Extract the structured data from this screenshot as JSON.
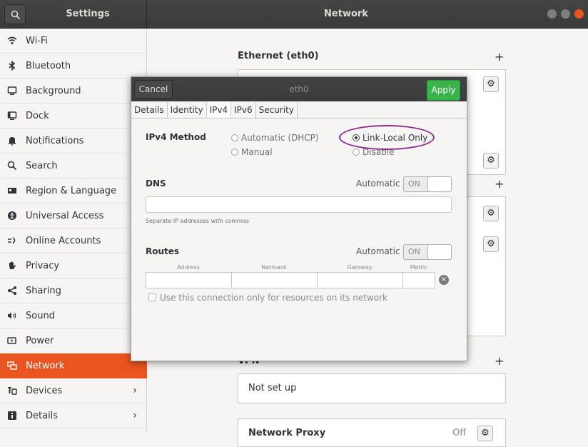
{
  "header": {
    "left_title": "Settings",
    "title": "Network"
  },
  "sidebar": {
    "items": [
      {
        "label": "Wi-Fi",
        "icon": "wifi-icon",
        "glyph": "•"
      },
      {
        "label": "Bluetooth",
        "icon": "bluetooth-icon",
        "glyph": "✲"
      },
      {
        "label": "Background",
        "icon": "background-icon",
        "glyph": "▣"
      },
      {
        "label": "Dock",
        "icon": "dock-icon",
        "glyph": "▢"
      },
      {
        "label": "Notifications",
        "icon": "bell-icon",
        "glyph": "▲"
      },
      {
        "label": "Search",
        "icon": "search-icon",
        "glyph": "⌕"
      },
      {
        "label": "Region & Language",
        "icon": "flag-icon",
        "glyph": "▤"
      },
      {
        "label": "Universal Access",
        "icon": "accessibility-icon",
        "glyph": "◉"
      },
      {
        "label": "Online Accounts",
        "icon": "accounts-icon",
        "glyph": "≈"
      },
      {
        "label": "Privacy",
        "icon": "hand-icon",
        "glyph": "✋"
      },
      {
        "label": "Sharing",
        "icon": "share-icon",
        "glyph": "<"
      },
      {
        "label": "Sound",
        "icon": "speaker-icon",
        "glyph": "◀"
      },
      {
        "label": "Power",
        "icon": "battery-icon",
        "glyph": "▮"
      },
      {
        "label": "Network",
        "icon": "network-icon",
        "glyph": "▦"
      },
      {
        "label": "Devices",
        "icon": "devices-icon",
        "glyph": "☌",
        "chevron": "›"
      },
      {
        "label": "Details",
        "icon": "info-icon",
        "glyph": "■",
        "chevron": "›"
      }
    ]
  },
  "main": {
    "ethernet_title": "Ethernet (eth0)",
    "plus": "+",
    "vpn_title": "VPN",
    "vpn_status": "Not set up",
    "proxy_title": "Network Proxy",
    "proxy_status": "Off"
  },
  "dialog": {
    "cancel_label": "Cancel",
    "title": "eth0",
    "apply_label": "Apply",
    "tabs": [
      "Details",
      "Identity",
      "IPv4",
      "IPv6",
      "Security"
    ],
    "active_tab": "IPv4",
    "ipv4_method_label": "IPv4 Method",
    "methods": {
      "automatic": "Automatic (DHCP)",
      "link_local": "Link-Local Only",
      "manual": "Manual",
      "disable": "Disable"
    },
    "selected_method": "Link-Local Only",
    "dns_label": "DNS",
    "automatic_label": "Automatic",
    "toggle_on": "ON",
    "dns_hint": "Separate IP addresses with commas",
    "routes_label": "Routes",
    "route_columns": [
      "Address",
      "Netmask",
      "Gateway",
      "Metric"
    ],
    "remove_glyph": "×",
    "checkbox_label": "Use this connection only for resources on its network"
  },
  "colors": {
    "accent": "#e95420",
    "apply": "#38b44a",
    "annotation": "#8b2b8a"
  }
}
